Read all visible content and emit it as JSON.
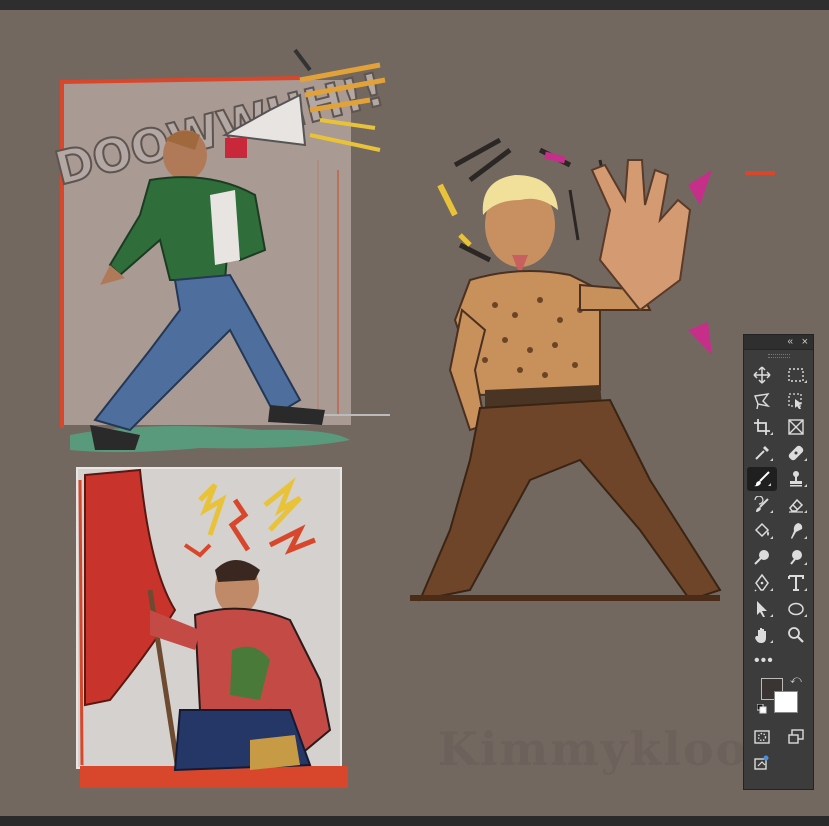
{
  "colors": {
    "canvas_bg": "#736860",
    "foreground": "#3a3432",
    "background": "#ffffff",
    "panel_bg": "#3c3c3c"
  },
  "artwork": {
    "lettering": "DOOWWHH!!",
    "watermark": "Kimmykloo"
  },
  "tools_panel": {
    "collapse_icon": "double-chevron-left-icon",
    "close_icon": "close-icon",
    "collapse_label": "«",
    "close_label": "×",
    "more_label": "•••",
    "swap_label": "⤺",
    "tools": [
      "move-tool-icon",
      "marquee-tool-icon",
      "lasso-tool-icon",
      "object-select-tool-icon",
      "crop-tool-icon",
      "frame-tool-icon",
      "eyedropper-tool-icon",
      "healing-brush-icon",
      "brush-tool-icon",
      "clone-stamp-icon",
      "history-brush-icon",
      "eraser-tool-icon",
      "paint-bucket-icon",
      "smudge-tool-icon",
      "dodge-tool-icon",
      "burn-tool-icon",
      "pen-tool-icon",
      "type-tool-icon",
      "path-select-icon",
      "ellipse-tool-icon",
      "hand-tool-icon",
      "zoom-tool-icon"
    ],
    "active_tool": "brush-tool-icon"
  }
}
